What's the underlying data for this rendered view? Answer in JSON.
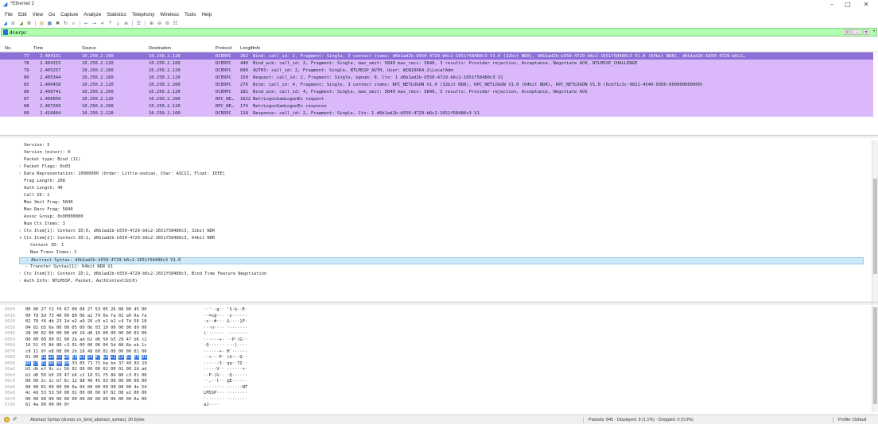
{
  "window": {
    "title": "*Ethernet 2",
    "min_label": "–",
    "max_label": "□",
    "close_label": "✕"
  },
  "menu": [
    "File",
    "Edit",
    "View",
    "Go",
    "Capture",
    "Analyze",
    "Statistics",
    "Telephony",
    "Wireless",
    "Tools",
    "Help"
  ],
  "toolbar": {
    "icons": [
      {
        "name": "shark-fin-start-icon",
        "glyph": "◢",
        "color": "#2c6fd6"
      },
      {
        "name": "stop-capture-icon",
        "glyph": "■",
        "color": "#c9c9c9"
      },
      {
        "name": "restart-capture-icon",
        "glyph": "◢",
        "color": "#5a9b3c"
      },
      {
        "name": "capture-options-icon",
        "glyph": "⚙",
        "color": "#555555"
      },
      {
        "name": "open-file-icon",
        "glyph": "▤",
        "color": "#d9a94a"
      },
      {
        "name": "save-file-icon",
        "glyph": "▦",
        "color": "#3b6ea8"
      },
      {
        "name": "close-file-icon",
        "glyph": "✖",
        "color": "#555555"
      },
      {
        "name": "reload-icon",
        "glyph": "↻",
        "color": "#555555"
      },
      {
        "name": "find-packet-icon",
        "glyph": "⌕",
        "color": "#555555"
      },
      {
        "name": "go-back-icon",
        "glyph": "←",
        "color": "#3b6ea8"
      },
      {
        "name": "go-forward-icon",
        "glyph": "→",
        "color": "#3b6ea8"
      },
      {
        "name": "go-to-packet-icon",
        "glyph": "↲",
        "color": "#3b6ea8"
      },
      {
        "name": "go-first-icon",
        "glyph": "⤒",
        "color": "#555555"
      },
      {
        "name": "go-last-icon",
        "glyph": "⤓",
        "color": "#555555"
      },
      {
        "name": "autoscroll-icon",
        "glyph": "≡",
        "color": "#555555"
      },
      {
        "name": "colorize-icon",
        "glyph": "☰",
        "color": "#7a5fc0"
      },
      {
        "name": "zoom-in-icon",
        "glyph": "⊕",
        "color": "#555555"
      },
      {
        "name": "zoom-out-icon",
        "glyph": "⊖",
        "color": "#555555"
      },
      {
        "name": "zoom-normal-icon",
        "glyph": "⊜",
        "color": "#555555"
      },
      {
        "name": "resize-columns-icon",
        "glyph": "☷",
        "color": "#555555"
      }
    ]
  },
  "filter": {
    "value": "dcerpc",
    "bg_color": "#afffaf",
    "clear_label": "⨯",
    "apply_label": "→",
    "dropdown_label": "▾",
    "add_label": "+"
  },
  "packet_list": {
    "columns": [
      "No.",
      "Time",
      "Source",
      "Destination",
      "Protocol",
      "Length",
      "Info"
    ],
    "row_color": "#dab8fa",
    "selected_color": "#8c70d8",
    "rows": [
      {
        "no": "77",
        "time": "2.404131",
        "src": "10.250.2.160",
        "dst": "10.250.2.120",
        "proto": "DCERPC",
        "len": "262",
        "info": "Bind: call_id: 2, Fragment: Single, 3 context items: d6b1ad2b-b550-4729-b6c2-1651f58480c3 V1.0 (32bit NDR), d6b1ad2b-b550-4729-b6c2-1651f58480c3 V1.0 (64bit NDR), d6b1ad2b-b550-4729-b6c2…",
        "selected": true
      },
      {
        "no": "78",
        "time": "2.404315",
        "src": "10.250.2.120",
        "dst": "10.250.2.160",
        "proto": "DCERPC",
        "len": "440",
        "info": "Bind_ack: call_id: 2, Fragment: Single, max_xmit: 5840 max_recv: 5840, 3 results: Provider rejection, Acceptance, Negotiate ACK, NTLMSSP_CHALLENGE"
      },
      {
        "no": "79",
        "time": "2.405257",
        "src": "10.250.2.160",
        "dst": "10.250.2.120",
        "proto": "DCERPC",
        "len": "600",
        "info": "AUTH3: call_id: 2, Fragment: Single, NTLMSSP_AUTH, User: WIN10X64-2\\LocalAdm"
      },
      {
        "no": "80",
        "time": "2.405344",
        "src": "10.250.2.160",
        "dst": "10.250.2.120",
        "proto": "DCERPC",
        "len": "150",
        "info": "Request: call_id: 2, Fragment: Single, opnum: 0, Ctx: 1 d6b1ad2b-b550-4729-b6c2-1651f58480c3 V1"
      },
      {
        "no": "85",
        "time": "2.406458",
        "src": "10.250.2.120",
        "dst": "10.250.2.200",
        "proto": "DCERPC",
        "len": "276",
        "info": "Bind: call_id: 4, Fragment: Single, 3 context items: RPC_NETLOGON V1.0 (32bit NDR), RPC_NETLOGON V1.0 (64bit NDR), RPC_NETLOGON V1.0 (6cb71c2c-9812-4540-0300-000000000000)"
      },
      {
        "no": "86",
        "time": "2.406741",
        "src": "10.250.2.200",
        "dst": "10.250.2.120",
        "proto": "DCERPC",
        "len": "182",
        "info": "Bind_ack: call_id: 4, Fragment: Single, max_xmit: 5840 max_recv: 5840, 3 results: Provider rejection, Acceptance, Negotiate ACK"
      },
      {
        "no": "87",
        "time": "2.406850",
        "src": "10.250.2.120",
        "dst": "10.250.2.200",
        "proto": "RPC_NE…",
        "len": "1022",
        "info": "NetrLogonSamLogonEx request"
      },
      {
        "no": "88",
        "time": "2.407269",
        "src": "10.250.2.200",
        "dst": "10.250.2.120",
        "proto": "RPC_NE…",
        "len": "174",
        "info": "NetrLogonSamLogonEx response"
      },
      {
        "no": "89",
        "time": "2.410404",
        "src": "10.250.2.120",
        "dst": "10.250.2.160",
        "proto": "DCERPC",
        "len": "118",
        "info": "Response: call_id: 2, Fragment: Single, Ctx: 1 d6b1ad2b-b550-4729-b6c2-1651f58480c3 V1"
      }
    ]
  },
  "details": {
    "lines": [
      {
        "indent": 0,
        "arrow": "",
        "text": "Version: 5"
      },
      {
        "indent": 0,
        "arrow": "",
        "text": "Version (minor): 0"
      },
      {
        "indent": 0,
        "arrow": "",
        "text": "Packet type: Bind (11)"
      },
      {
        "indent": 0,
        "arrow": "›",
        "text": "Packet Flags: 0x03"
      },
      {
        "indent": 0,
        "arrow": "›",
        "text": "Data Representation: 10000000 (Order: Little-endian, Char: ASCII, Float: IEEE)"
      },
      {
        "indent": 0,
        "arrow": "",
        "text": "Frag Length: 208"
      },
      {
        "indent": 0,
        "arrow": "",
        "text": "Auth Length: 40"
      },
      {
        "indent": 0,
        "arrow": "",
        "text": "Call ID: 2"
      },
      {
        "indent": 0,
        "arrow": "",
        "text": "Max Xmit Frag: 5840"
      },
      {
        "indent": 0,
        "arrow": "",
        "text": "Max Recv Frag: 5840"
      },
      {
        "indent": 0,
        "arrow": "",
        "text": "Assoc Group: 0x00000000"
      },
      {
        "indent": 0,
        "arrow": "",
        "text": "Num Ctx Items: 3"
      },
      {
        "indent": 0,
        "arrow": "›",
        "text": "Ctx Item[1]: Context ID:0, d6b1ad2b-b550-4729-b6c2-1651f58480c3, 32bit NDR"
      },
      {
        "indent": 0,
        "arrow": "∨",
        "text": "Ctx Item[2]: Context ID:1, d6b1ad2b-b550-4729-b6c2-1651f58480c3, 64bit NDR"
      },
      {
        "indent": 1,
        "arrow": "",
        "text": "Context ID: 1"
      },
      {
        "indent": 1,
        "arrow": "",
        "text": "Num Trans Items: 1"
      },
      {
        "indent": 1,
        "arrow": "›",
        "text": "Abstract Syntax: d6b1ad2b-b550-4729-b6c2-1651f58480c3 V1.0",
        "highlight": true
      },
      {
        "indent": 1,
        "arrow": "›",
        "text": "Transfer Syntax[1]: 64bit NDR V1"
      },
      {
        "indent": 0,
        "arrow": "›",
        "text": "Ctx Item[3]: Context ID:2, d6b1ad2b-b550-4729-b6c2-1651f58480c3, Bind Time Feature Negotiation"
      },
      {
        "indent": 0,
        "arrow": "›",
        "text": "Auth Info: NTLMSSP, Packet, AuthContextId(0)"
      }
    ]
  },
  "bytes": {
    "rows": [
      {
        "off": "0000",
        "hex": "00 00 27 f2 f6 67 00 00  27 53 05 26 08 00 45 00",
        "ascii": "··'··g·· 'S·&··E·"
      },
      {
        "off": "0010",
        "hex": "00 f8 3d 73 40 00 80 06  a1 79 0a fa 02 a0 0a fa",
        "ascii": "··=s@··· ·y······"
      },
      {
        "off": "0020",
        "hex": "02 78 f6 db 23 1d e2 a9  26 c9 e1 b2 c4 7d 50 18",
        "ascii": "·x··#··· &····}P·"
      },
      {
        "off": "0030",
        "hex": "04 02 b5 6e 00 00 05 00  0b 03 10 00 00 00 d0 00",
        "ascii": "···n···· ········"
      },
      {
        "off": "0040",
        "hex": "28 00 02 00 00 00 d0 16  d0 16 00 00 00 00 03 00",
        "ascii": "(······· ········"
      },
      {
        "off": "0050",
        "hex": "00 00 00 00 01 00 2b ad  b1 d6 50 b5 29 47 b6 c2",
        "ascii": "······+· ··P·)G··"
      },
      {
        "off": "0060",
        "hex": "16 51 f5 84 80 c3 01 00  00 00 04 5d 88 8a eb 1c",
        "ascii": "·Q······ ···]····"
      },
      {
        "off": "0070",
        "hex": "c9 11 9f e8 08 00 2b 10  48 60 02 00 00 00 01 00",
        "ascii": "······+· H`······"
      },
      {
        "off": "0080",
        "hex": "01 00 2b ad b1 d6 50 b5  29 47 b6 c2 16 51 f5 84",
        "ascii": "··+···P· )G···Q··",
        "sel": [
          2,
          16
        ]
      },
      {
        "off": "0090",
        "hex": "80 c3 01 00 00 00 33 05  71 71 ba be 37 49 83 19",
        "ascii": "······3· qq··7I··",
        "sel": [
          0,
          6
        ]
      },
      {
        "off": "00a0",
        "hex": "b5 db ef 9c cc 56 01 00  00 00 02 00 01 00 2b ad",
        "ascii": "·····V·· ······+·"
      },
      {
        "off": "00b0",
        "hex": "b1 d6 50 b5 29 47 b6 c2  16 51 f5 84 80 c3 01 00",
        "ascii": "··P·)G·· ·Q······"
      },
      {
        "off": "00c0",
        "hex": "00 00 2c 1c b7 6c 12 98  40 45 03 00 00 00 00 00",
        "ascii": "··,··l·· @E······"
      },
      {
        "off": "00d0",
        "hex": "00 00 01 00 00 00 0a 04  00 00 00 00 00 00 4e 54",
        "ascii": "········ ······NT"
      },
      {
        "off": "00e0",
        "hex": "4c 4d 53 53 50 00 01 00  00 00 97 82 08 e2 00 00",
        "ascii": "LMSSP··· ········"
      },
      {
        "off": "00f0",
        "hex": "00 00 00 00 00 00 00 00  00 00 00 00 00 00 0a 00",
        "ascii": "········ ········"
      },
      {
        "off": "0100",
        "hex": "61 4a 00 00 00 0f",
        "ascii": "aJ····"
      }
    ]
  },
  "status": {
    "field_text": "Abstract Syntax (dcerpc.cn_bind_abstract_syntax), 20 bytes",
    "packets_text": "Packets: 845 · Displayed: 9 (1.1%) · Dropped: 0 (0.0%)",
    "profile_text": "Profile: Default",
    "edit_glyph": "✐"
  }
}
